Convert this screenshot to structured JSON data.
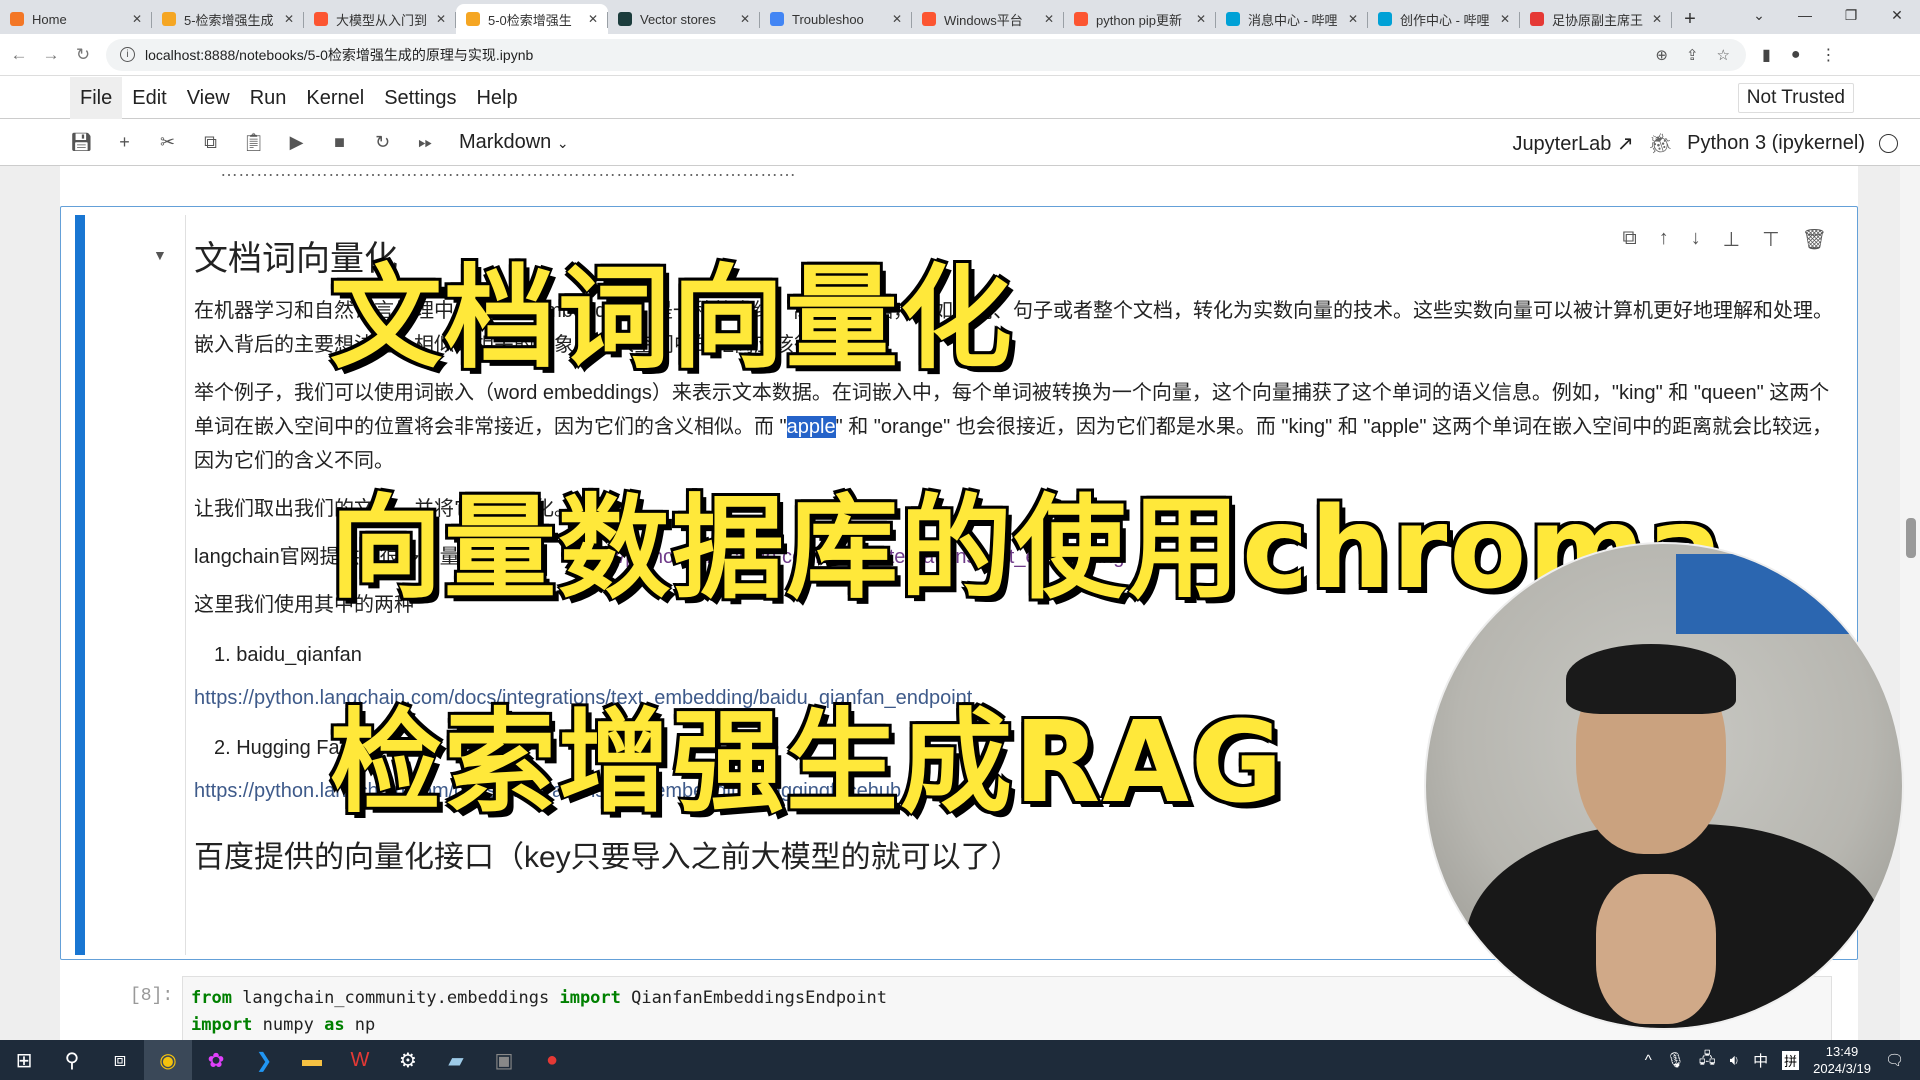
{
  "browser": {
    "tabs": [
      {
        "title": "Home",
        "icon": "jupyter-icon",
        "color": "#f37726",
        "active": false
      },
      {
        "title": "5-检索增强生成",
        "icon": "notebook-icon",
        "color": "#f5a623",
        "active": false
      },
      {
        "title": "大模型从入门到",
        "icon": "csdn-icon",
        "color": "#fc5531",
        "active": false
      },
      {
        "title": "5-0检索增强生",
        "icon": "notebook-icon",
        "color": "#f5a623",
        "active": true
      },
      {
        "title": "Vector stores",
        "icon": "langchain-icon",
        "color": "#1c3c3c",
        "active": false
      },
      {
        "title": "Troubleshoo",
        "icon": "search-icon",
        "color": "#4285f4",
        "active": false
      },
      {
        "title": "Windows平台",
        "icon": "csdn-icon",
        "color": "#fc5531",
        "active": false
      },
      {
        "title": "python pip更新",
        "icon": "csdn-icon",
        "color": "#fc5531",
        "active": false
      },
      {
        "title": "消息中心 - 哔哩",
        "icon": "bilibili-icon",
        "color": "#00a1d6",
        "active": false
      },
      {
        "title": "创作中心 - 哔哩",
        "icon": "bilibili-icon",
        "color": "#00a1d6",
        "active": false
      },
      {
        "title": "足协原副主席王",
        "icon": "netease-icon",
        "color": "#e53935",
        "active": false
      }
    ],
    "close_glyph": "✕",
    "new_tab": "+",
    "url": "localhost:8888/notebooks/5-0检索增强生成的原理与实现.ipynb"
  },
  "jupyter": {
    "menu": [
      "File",
      "Edit",
      "View",
      "Run",
      "Kernel",
      "Settings",
      "Help"
    ],
    "trust_label": "Not Trusted",
    "cell_type": "Markdown",
    "jupyterlab_label": "JupyterLab",
    "kernel_label": "Python 3 (ipykernel)"
  },
  "cell": {
    "heading": "文档词向量化",
    "p1": "在机器学习和自然语言处理中，嵌入（embedding）是一种将高维、离散的数据，比如单词、句子或者整个文档，转化为实数向量的技术。这些实数向量可以被计算机更好地理解和处理。嵌入背后的主要想法是，相似或相关的对象在嵌入空间中的距离应该很近。",
    "p2_a": "举个例子，我们可以使用词嵌入（word embeddings）来表示文本数据。在词嵌入中，每个单词被转换为一个向量，这个向量捕获了这个单词的语义信息。例如，\"king\" 和 \"queen\" 这两个单词在嵌入空间中的位置将会非常接近，因为它们的含义相似。而 \"",
    "p2_sel": "apple",
    "p2_b": "\" 和 \"orange\" 也会很接近，因为它们都是水果。而 \"king\" 和 \"apple\" 这两个单词在嵌入空间中的距离就会比较远，因为它们的含义不同。",
    "p3": "让我们取出我们的文档，并将它们向量化。",
    "p4_text": "langchain官网提供了很多向量化的模型：",
    "p4_link": "https://python.langchain.com/docs/integrations/text_embedding",
    "p5": "这里我们使用其中的两种",
    "li1": "1. baidu_qianfan",
    "li1_link": "https://python.langchain.com/docs/integrations/text_embedding/baidu_qianfan_endpoint",
    "li2": "2. Hugging Face",
    "li2_link": "https://python.langchain.com/docs/integrations/text_embedding/huggingfacehub",
    "h2b": "百度提供的向量化接口（key只要导入之前大模型的就可以了）"
  },
  "code_cell": {
    "prompt": "[8]:",
    "line1_kw1": "from",
    "line1_mod": " langchain_community.embeddings ",
    "line1_kw2": "import",
    "line1_name": " QianfanEmbeddingsEndpoint",
    "line2_kw1": "import",
    "line2_mod": " numpy ",
    "line2_kw2": "as",
    "line2_name": " np"
  },
  "overlay": {
    "caption1": "文档词向量化",
    "caption2": "向量数据库的使用chroma",
    "caption3": "检索增强生成RAG"
  },
  "taskbar": {
    "time": "13:49",
    "date": "2024/3/19",
    "ime": "中",
    "ime2": "拼"
  }
}
